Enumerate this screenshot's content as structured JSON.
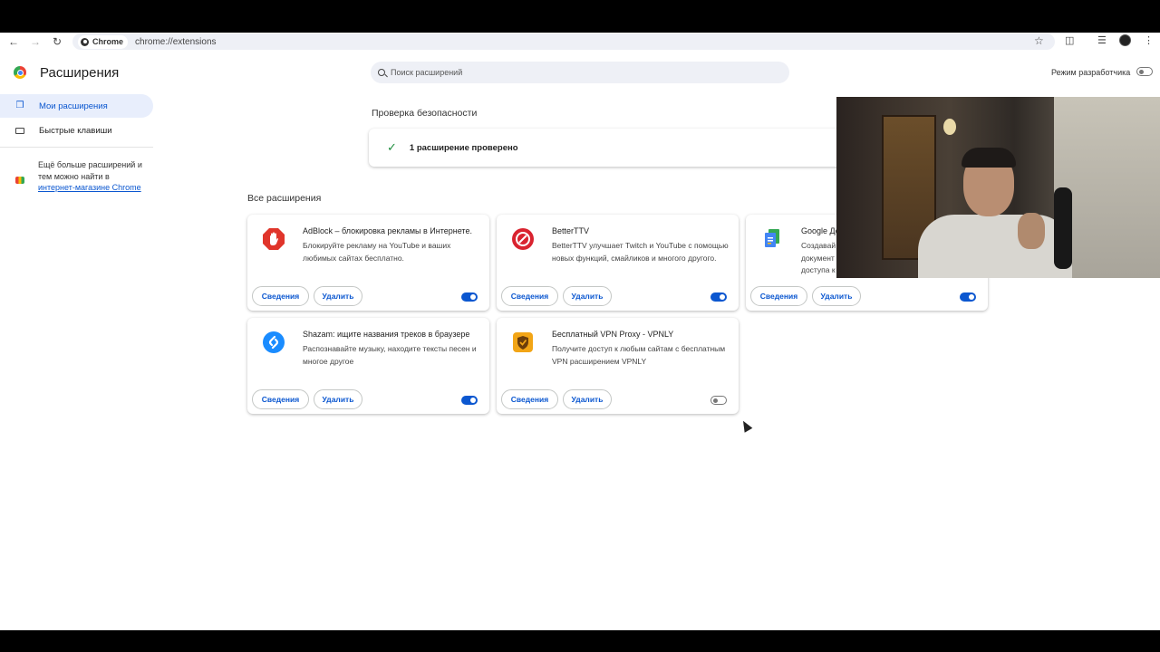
{
  "browser": {
    "chip_label": "Chrome",
    "url": "chrome://extensions"
  },
  "page": {
    "title": "Расширения",
    "search_placeholder": "Поиск расширений",
    "dev_mode_label": "Режим разработчика",
    "dev_mode_on": false
  },
  "sidebar": {
    "items": [
      {
        "label": "Мои расширения",
        "icon": "puzzle-icon",
        "active": true
      },
      {
        "label": "Быстрые клавиши",
        "icon": "keyboard-icon",
        "active": false
      }
    ],
    "more_text": "Ещё больше расширений и тем можно найти в",
    "more_link": "интернет-магазине Chrome"
  },
  "safety": {
    "title": "Проверка безопасности",
    "status": "1 расширение проверено"
  },
  "extensions_section_title": "Все расширения",
  "extensions": [
    {
      "name": "AdBlock – блокировка рекламы в Интернете.",
      "desc": "Блокируйте рекламу на YouTube и ваших любимых сайтах бесплатно.",
      "enabled": true,
      "icon": "adblock-icon",
      "color": "#e0352b"
    },
    {
      "name": "BetterTTV",
      "desc": "BetterTTV улучшает Twitch и YouTube с помощью новых функций, смайликов и многого другого.",
      "enabled": true,
      "icon": "betterttv-icon",
      "color": "#d9232f"
    },
    {
      "name": "Google До",
      "desc": "Создавай документ доступа к",
      "enabled": true,
      "icon": "google-docs-icon",
      "color": "#4285f4"
    },
    {
      "name": "Shazam: ищите названия треков в браузере",
      "desc": "Распознавайте музыку, находите тексты песен и многое другое",
      "enabled": true,
      "icon": "shazam-icon",
      "color": "#1a8cff"
    },
    {
      "name": "Бесплатный VPN Proxy - VPNLY",
      "desc": "Получите доступ к любым сайтам с бесплатным VPN расширением VPNLY",
      "enabled": false,
      "icon": "vpnly-icon",
      "color": "#f2a516"
    }
  ],
  "buttons": {
    "details": "Сведения",
    "remove": "Удалить"
  }
}
